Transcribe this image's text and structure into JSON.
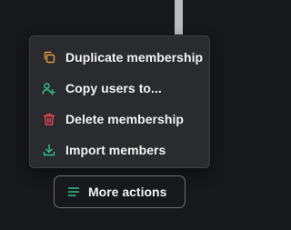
{
  "menu": {
    "items": [
      {
        "label": "Duplicate membership",
        "icon": "copy-icon",
        "icon_color": "#e39a3b"
      },
      {
        "label": "Copy users to...",
        "icon": "user-plus-icon",
        "icon_color": "#33c28a"
      },
      {
        "label": "Delete membership",
        "icon": "trash-icon",
        "icon_color": "#e5484d"
      },
      {
        "label": "Import members",
        "icon": "download-icon",
        "icon_color": "#33c28a"
      }
    ]
  },
  "more_actions": {
    "label": "More actions",
    "icon": "menu-lines-icon",
    "icon_color": "#33c28a"
  },
  "colors": {
    "background": "#17181b",
    "menu_background": "#2a2b2f",
    "text": "#f2f2f3"
  }
}
